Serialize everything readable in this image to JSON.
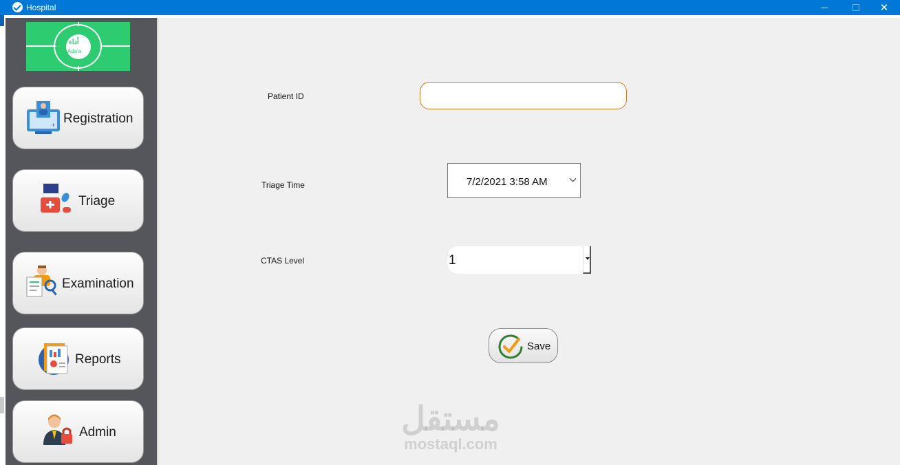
{
  "window": {
    "title": "Hospital",
    "minimize": "",
    "maximize": "",
    "close": "✕"
  },
  "logo": {
    "brand_ar": "أداء",
    "brand_en": "Ada'a"
  },
  "sidebar": {
    "items": [
      {
        "label": "Registration",
        "icon": "registration-icon"
      },
      {
        "label": "Triage",
        "icon": "triage-icon"
      },
      {
        "label": "Examination",
        "icon": "examination-icon"
      },
      {
        "label": "Reports",
        "icon": "reports-icon"
      },
      {
        "label": "Admin",
        "icon": "admin-icon"
      }
    ]
  },
  "form": {
    "patient_id_label": "Patient ID",
    "patient_id_value": "",
    "triage_time_label": "Triage Time",
    "triage_time_value": "7/2/2021 3:58 AM",
    "ctas_label": "CTAS Level",
    "ctas_value": "1",
    "save_label": "Save"
  },
  "watermark": {
    "ar": "مستقل",
    "en": "mostaql.com"
  },
  "colors": {
    "titlebar": "#0078d7",
    "sidebar": "#55565b",
    "accent_input_border": "#cc7a1e",
    "logo_bg": "#2ecc71"
  }
}
